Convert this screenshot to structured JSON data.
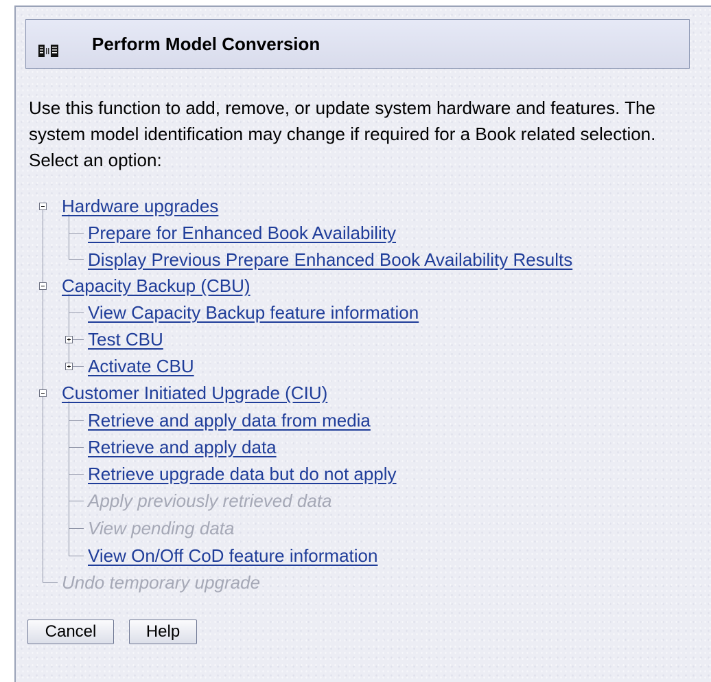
{
  "header": {
    "title": "Perform Model Conversion",
    "icon": "server-books-icon"
  },
  "description": "Use this function to add, remove, or update system hardware and features. The system model identification may change if required for a Book related selection. Select an option:",
  "tree": {
    "hardware": {
      "label": "Hardware upgrades",
      "state": "expanded",
      "items": [
        {
          "label": "Prepare for Enhanced Book Availability",
          "enabled": true
        },
        {
          "label": "Display Previous Prepare Enhanced Book Availability Results",
          "enabled": true
        }
      ]
    },
    "cbu": {
      "label": "Capacity Backup (CBU)",
      "state": "expanded",
      "items": [
        {
          "label": "View Capacity Backup feature information",
          "enabled": true
        },
        {
          "label": "Test CBU",
          "enabled": true,
          "state": "collapsed"
        },
        {
          "label": "Activate CBU",
          "enabled": true,
          "state": "collapsed"
        }
      ]
    },
    "ciu": {
      "label": "Customer Initiated Upgrade (CIU)",
      "state": "expanded",
      "items": [
        {
          "label": "Retrieve and apply data from media",
          "enabled": true
        },
        {
          "label": "Retrieve and apply data",
          "enabled": true
        },
        {
          "label": "Retrieve upgrade data but do not apply",
          "enabled": true
        },
        {
          "label": "Apply previously retrieved data",
          "enabled": false
        },
        {
          "label": "View pending data",
          "enabled": false
        },
        {
          "label": "View On/Off CoD feature information",
          "enabled": true
        }
      ]
    },
    "undo": {
      "label": "Undo temporary upgrade",
      "enabled": false
    }
  },
  "buttons": {
    "cancel": "Cancel",
    "help": "Help"
  },
  "colors": {
    "link": "#1f3d99",
    "disabled": "#a5a8b6",
    "panel_bg": "#ecedf4"
  }
}
